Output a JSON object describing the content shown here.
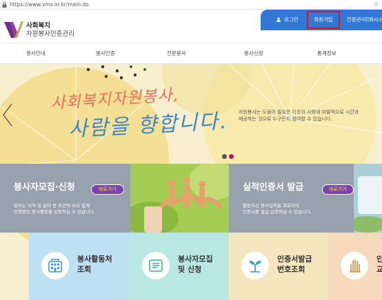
{
  "browser": {
    "url": "https://www.vms.or.kr/main.do"
  },
  "header": {
    "logo_line1": "사회복지",
    "logo_line2": "자원봉사인증관리",
    "login_label": "로그인",
    "join_label": "회원가입",
    "cert_label": "인증관리DB시스"
  },
  "nav": {
    "items": [
      "봉사안내",
      "봉사인증",
      "전문봉사",
      "봉사신청",
      "통계정보"
    ]
  },
  "hero": {
    "headline_line1": "사회복지자원봉사,",
    "headline_line2": "사람을 향합니다.",
    "description_line1": "자원봉사는 도움이 필요한 이웃과 사회에 자발적으로 시간과",
    "description_line2": "제공하는 것으로 누구든지 참여할 수 있습니다.",
    "slider_dots": 2,
    "active_dot": 2
  },
  "cards": [
    {
      "title": "봉사자모집·신청",
      "button": "바로가기",
      "desc_line1": "원하는 지역 및 분야 등 조건에 따라 쉽게",
      "desc_line2": "진행중인 봉사활동을 신청하실 수 있습니다."
    },
    {
      "title": "실적인증서 발급",
      "button": "바로가기",
      "desc_line1": "활동하신 봉사실적을 조회하여",
      "desc_line2": "인증서를 발급 신청하실 수 있습니다."
    }
  ],
  "tiles": [
    {
      "line1": "봉사활동처",
      "line2": "조회",
      "icon": "building-icon",
      "color": "#bde0f2"
    },
    {
      "line1": "봉사자모집",
      "line2": "및 신청",
      "icon": "document-icon",
      "color": "#b9e7e3"
    },
    {
      "line1": "인증서발급",
      "line2": "번호조회",
      "icon": "sprout-icon",
      "color": "#f4e6bf"
    },
    {
      "line1": "인",
      "line2": "교",
      "icon": "hand-icon",
      "color": "#f6d9bb"
    }
  ],
  "colors": {
    "accent": "#3377d6",
    "highlight": "#d1162a",
    "button": "#7d44a8",
    "headline_pink": "#ef6c5b",
    "headline_blue": "#3f86c8"
  }
}
